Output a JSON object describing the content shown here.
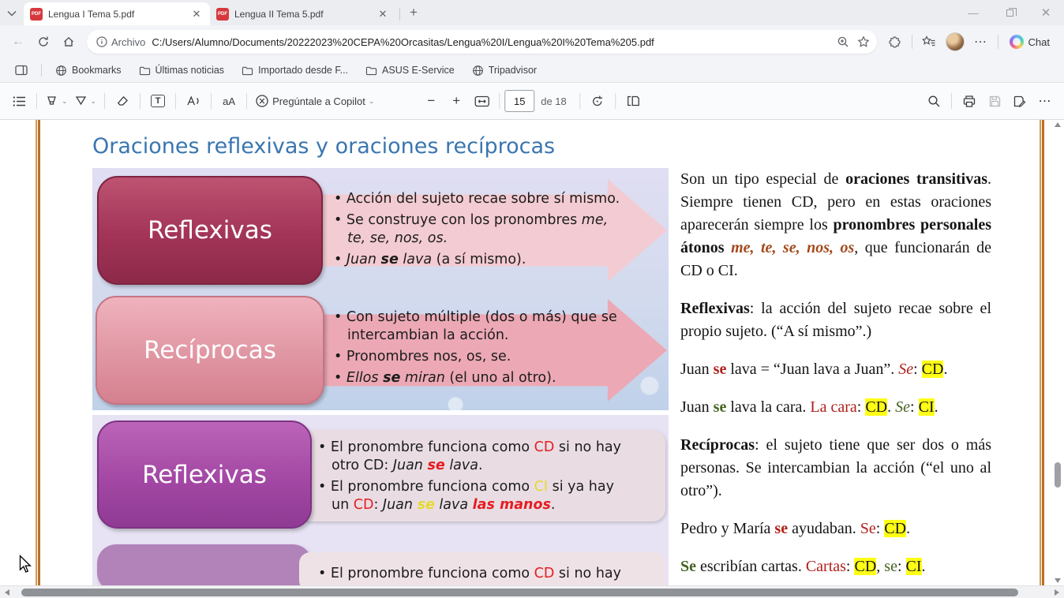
{
  "tabs": {
    "items": [
      {
        "title": "Lengua I Tema 5.pdf",
        "active": true
      },
      {
        "title": "Lengua II Tema 5.pdf",
        "active": false
      }
    ]
  },
  "navbar": {
    "scheme_label": "Archivo",
    "url": "C:/Users/Alumno/Documents/20222023%20CEPA%20Orcasitas/Lengua%20I/Lengua%20I%20Tema%205.pdf",
    "chat_label": "Chat"
  },
  "bookmarks_bar": {
    "items": [
      {
        "label": "Bookmarks",
        "icon": "globe-icon"
      },
      {
        "label": "Últimas noticias",
        "icon": "folder-icon"
      },
      {
        "label": "Importado desde F...",
        "icon": "folder-icon"
      },
      {
        "label": "ASUS E-Service",
        "icon": "folder-icon"
      },
      {
        "label": "Tripadvisor",
        "icon": "globe-icon"
      }
    ]
  },
  "pdf_toolbar": {
    "copilot_label": "Pregúntale a Copilot",
    "page_number": "15",
    "page_count_label": "de 18"
  },
  "doc": {
    "title": "Oraciones reflexivas y oraciones recíprocas",
    "slide1": {
      "rows": [
        {
          "label": "Reflexivas",
          "bullets": [
            [
              {
                "t": "Acción del sujeto recae sobre sí mismo."
              }
            ],
            [
              {
                "t": "Se construye con los pronombres "
              },
              {
                "t": "me, te, se, nos, os.",
                "c": "i"
              }
            ],
            [
              {
                "t": "Juan ",
                "c": "i"
              },
              {
                "t": "se",
                "c": "bi"
              },
              {
                "t": " lava",
                "c": "i"
              },
              {
                "t": " (a sí mismo)."
              }
            ]
          ]
        },
        {
          "label": "Recíprocas",
          "bullets": [
            [
              {
                "t": "Con sujeto múltiple (dos o más) que se intercambian la acción."
              }
            ],
            [
              {
                "t": "Pronombres nos, os, se."
              }
            ],
            [
              {
                "t": "Ellos ",
                "c": "i"
              },
              {
                "t": "se",
                "c": "bi"
              },
              {
                "t": " miran",
                "c": "i"
              },
              {
                "t": " (el uno al otro)."
              }
            ]
          ]
        }
      ]
    },
    "slide2": {
      "rows": [
        {
          "label": "Reflexivas",
          "bullets": [
            [
              {
                "t": "El pronombre funciona como "
              },
              {
                "t": "CD",
                "c": "red"
              },
              {
                "t": " si no hay otro CD: "
              },
              {
                "t": "Juan ",
                "c": "i"
              },
              {
                "t": "se",
                "c": "bi red"
              },
              {
                "t": " lava",
                "c": "i"
              },
              {
                "t": "."
              }
            ],
            [
              {
                "t": "El pronombre funciona como "
              },
              {
                "t": "CI",
                "c": "yel"
              },
              {
                "t": " si ya hay un "
              },
              {
                "t": "CD",
                "c": "red"
              },
              {
                "t": ": "
              },
              {
                "t": "Juan ",
                "c": "i"
              },
              {
                "t": "se",
                "c": "bi yel"
              },
              {
                "t": " lava ",
                "c": "i"
              },
              {
                "t": "las manos",
                "c": "bi red"
              },
              {
                "t": "."
              }
            ]
          ]
        },
        {
          "label": "",
          "bullets": [
            [
              {
                "t": "El pronombre funciona como "
              },
              {
                "t": "CD",
                "c": "red"
              },
              {
                "t": " si no hay"
              }
            ]
          ]
        }
      ]
    },
    "right_column": {
      "paragraphs": [
        [
          {
            "t": "Son un tipo especial de "
          },
          {
            "t": "oraciones transitivas",
            "c": "b"
          },
          {
            "t": ". Siempre tienen CD, pero en estas oraciones aparecerán siempre los "
          },
          {
            "t": "pronombres personales átonos",
            "c": "b"
          },
          {
            "t": " "
          },
          {
            "t": "me, te, se, nos, os",
            "c": "bi brown"
          },
          {
            "t": ", que funcionarán de CD o CI."
          }
        ],
        [
          {
            "t": "Reflexivas",
            "c": "b"
          },
          {
            "t": ": la acción del sujeto recae sobre el propio sujeto. (“A sí mismo”.)"
          }
        ],
        [
          {
            "t": "Juan "
          },
          {
            "t": "se",
            "c": "b dred"
          },
          {
            "t": " lava = “Juan lava a Juan”. "
          },
          {
            "t": "Se",
            "c": "i dred"
          },
          {
            "t": ": "
          },
          {
            "t": "CD",
            "c": "hl"
          },
          {
            "t": "."
          }
        ],
        [
          {
            "t": "Juan "
          },
          {
            "t": "se",
            "c": "b green"
          },
          {
            "t": " lava la cara. "
          },
          {
            "t": "La cara",
            "c": "dred"
          },
          {
            "t": ": "
          },
          {
            "t": "CD",
            "c": "hl"
          },
          {
            "t": ". "
          },
          {
            "t": "Se",
            "c": "i green"
          },
          {
            "t": ": "
          },
          {
            "t": "CI",
            "c": "hl"
          },
          {
            "t": "."
          }
        ],
        [
          {
            "t": "Recíprocas",
            "c": "b"
          },
          {
            "t": ": el sujeto tiene que ser dos o más personas. Se intercambian la acción (“el uno al otro”)."
          }
        ],
        [
          {
            "t": "Pedro y María "
          },
          {
            "t": "se",
            "c": "b dred"
          },
          {
            "t": " ayudaban. "
          },
          {
            "t": "Se",
            "c": "dred"
          },
          {
            "t": ": "
          },
          {
            "t": "CD",
            "c": "hl"
          },
          {
            "t": "."
          }
        ],
        [
          {
            "t": "Se",
            "c": "b green"
          },
          {
            "t": " escribían cartas. "
          },
          {
            "t": "Cartas",
            "c": "dred"
          },
          {
            "t": ": "
          },
          {
            "t": "CD",
            "c": "hl"
          },
          {
            "t": ", "
          },
          {
            "t": "se",
            "c": "green"
          },
          {
            "t": ": "
          },
          {
            "t": "CI",
            "c": "hl"
          },
          {
            "t": "."
          }
        ]
      ]
    }
  }
}
